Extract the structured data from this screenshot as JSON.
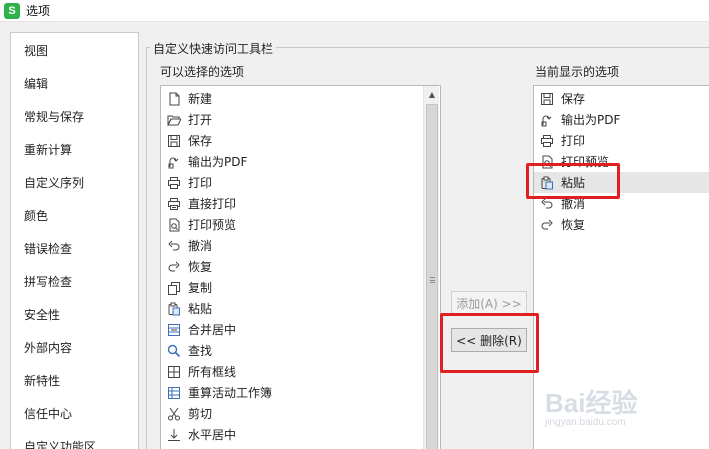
{
  "window": {
    "title": "选项",
    "logo_text": "S"
  },
  "categories": [
    "视图",
    "编辑",
    "常规与保存",
    "重新计算",
    "自定义序列",
    "颜色",
    "错误检查",
    "拼写检查",
    "安全性",
    "外部内容",
    "新特性",
    "信任中心",
    "自定义功能区"
  ],
  "group_title": "自定义快速访问工具栏",
  "available": {
    "label": "可以选择的选项",
    "items": [
      {
        "label": "新建",
        "icon": "new-file-icon"
      },
      {
        "label": "打开",
        "icon": "folder-open-icon"
      },
      {
        "label": "保存",
        "icon": "save-icon"
      },
      {
        "label": "输出为PDF",
        "icon": "export-pdf-icon"
      },
      {
        "label": "打印",
        "icon": "print-icon"
      },
      {
        "label": "直接打印",
        "icon": "direct-print-icon"
      },
      {
        "label": "打印预览",
        "icon": "print-preview-icon"
      },
      {
        "label": "撤消",
        "icon": "undo-icon"
      },
      {
        "label": "恢复",
        "icon": "redo-icon"
      },
      {
        "label": "复制",
        "icon": "copy-icon"
      },
      {
        "label": "粘贴",
        "icon": "paste-icon"
      },
      {
        "label": "合并居中",
        "icon": "merge-center-icon"
      },
      {
        "label": "查找",
        "icon": "find-icon"
      },
      {
        "label": "所有框线",
        "icon": "all-borders-icon"
      },
      {
        "label": "重算活动工作簿",
        "icon": "recalculate-icon"
      },
      {
        "label": "剪切",
        "icon": "cut-icon"
      },
      {
        "label": "水平居中",
        "icon": "align-center-icon"
      }
    ]
  },
  "current": {
    "label": "当前显示的选项",
    "items": [
      {
        "label": "保存",
        "icon": "save-icon"
      },
      {
        "label": "输出为PDF",
        "icon": "export-pdf-icon"
      },
      {
        "label": "打印",
        "icon": "print-icon"
      },
      {
        "label": "打印预览",
        "icon": "print-preview-icon"
      },
      {
        "label": "粘贴",
        "icon": "paste-icon",
        "selected": true
      },
      {
        "label": "撤消",
        "icon": "undo-icon"
      },
      {
        "label": "恢复",
        "icon": "redo-icon"
      }
    ]
  },
  "buttons": {
    "add": "添加(A) >>",
    "remove": "<< 删除(R)"
  },
  "watermark": {
    "main": "Bai经验",
    "sub": "jingyan.baidu.com"
  },
  "colors": {
    "annotation": "#e02020",
    "logo": "#2fb24c"
  }
}
